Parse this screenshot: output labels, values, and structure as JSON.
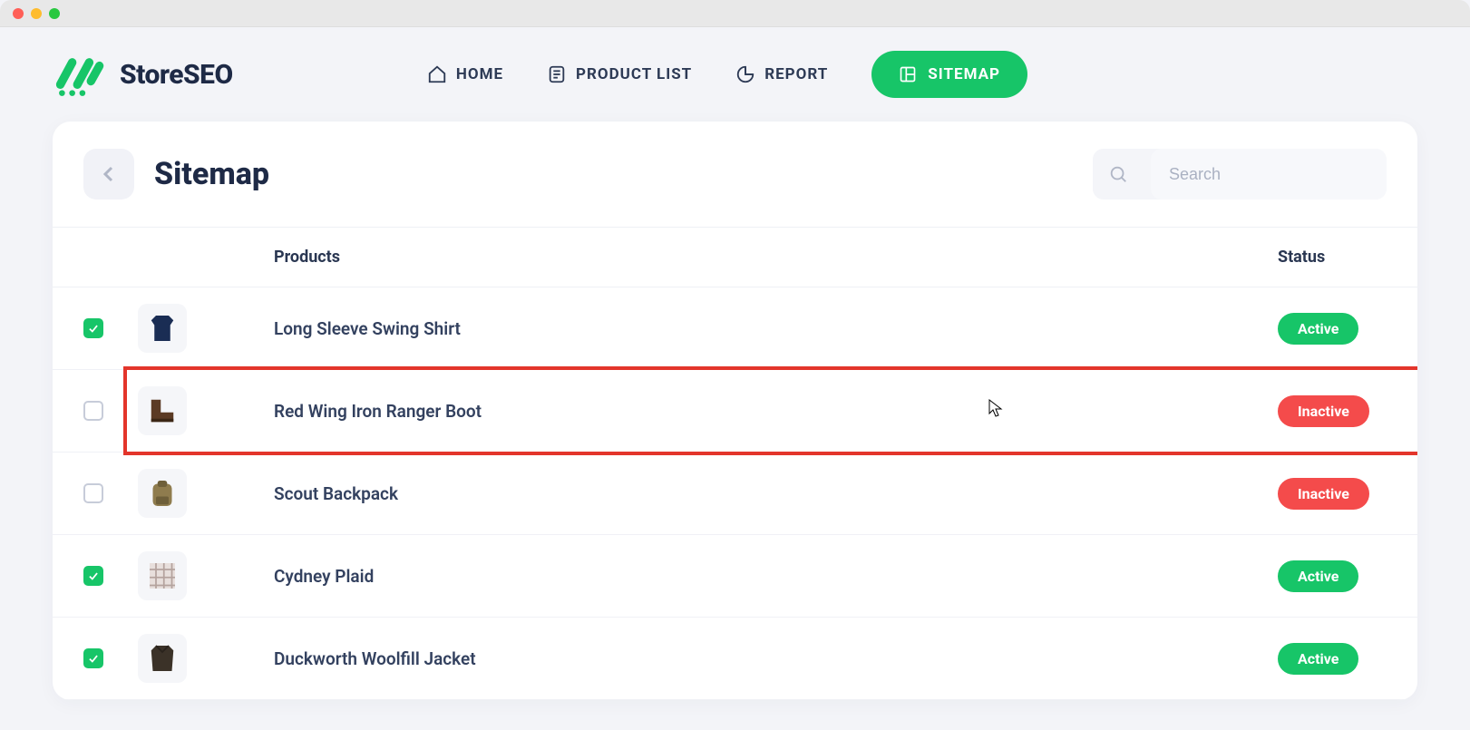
{
  "brand": {
    "name": "StoreSEO"
  },
  "nav": {
    "home": "HOME",
    "product_list": "PRODUCT LIST",
    "report": "REPORT",
    "sitemap": "SITEMAP"
  },
  "page": {
    "title": "Sitemap",
    "search_placeholder": "Search"
  },
  "table": {
    "columns": {
      "products": "Products",
      "status": "Status"
    },
    "rows": [
      {
        "checked": true,
        "name": "Long Sleeve Swing Shirt",
        "status": "Active",
        "status_kind": "active",
        "highlight": false,
        "thumb": "sweater"
      },
      {
        "checked": false,
        "name": "Red Wing Iron Ranger Boot",
        "status": "Inactive",
        "status_kind": "inactive",
        "highlight": true,
        "thumb": "boot"
      },
      {
        "checked": false,
        "name": "Scout Backpack",
        "status": "Inactive",
        "status_kind": "inactive",
        "highlight": false,
        "thumb": "backpack"
      },
      {
        "checked": true,
        "name": "Cydney Plaid",
        "status": "Active",
        "status_kind": "active",
        "highlight": false,
        "thumb": "plaid"
      },
      {
        "checked": true,
        "name": "Duckworth Woolfill Jacket",
        "status": "Active",
        "status_kind": "active",
        "highlight": false,
        "thumb": "jacket"
      }
    ]
  },
  "status_labels": {
    "active": "Active",
    "inactive": "Inactive"
  },
  "colors": {
    "accent": "#17c568",
    "danger": "#f44b4b",
    "highlight_border": "#e3352b",
    "text": "#1e2a46"
  }
}
